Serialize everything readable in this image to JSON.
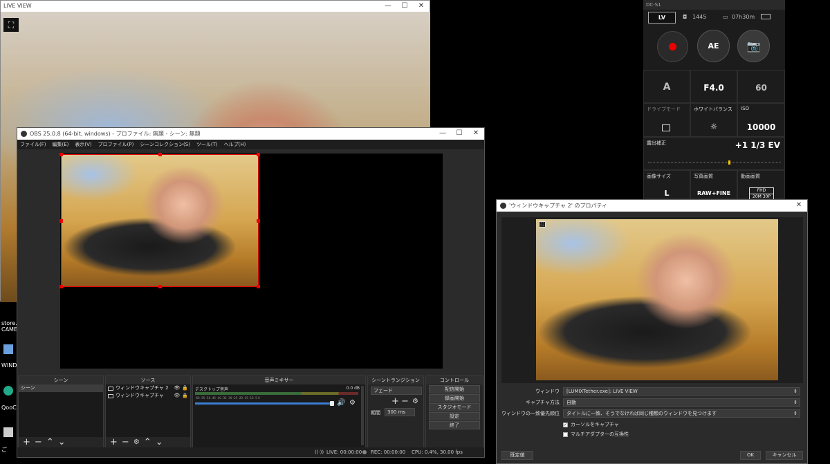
{
  "live_view": {
    "title": "LIVE VIEW"
  },
  "desktop": {
    "icon1_label": "store.m",
    "icon1_sub": "CAME",
    "icon2_label": "WINDO",
    "icon3_label": "QooC",
    "icon4_label": "ご"
  },
  "obs": {
    "title": "OBS 25.0.8 (64-bit, windows) - プロファイル: 無題 - シーン: 無題",
    "menu": [
      "ファイル(F)",
      "編集(E)",
      "表示(V)",
      "プロファイル(P)",
      "シーンコレクション(S)",
      "ツール(T)",
      "ヘルプ(H)"
    ],
    "docks": {
      "scenes": {
        "title": "シーン",
        "items": [
          "シーン"
        ]
      },
      "sources": {
        "title": "ソース",
        "items": [
          "ウィンドウキャプチャ 2",
          "ウィンドウキャプチャ"
        ]
      },
      "mixer": {
        "title": "音声ミキサー",
        "track": "デスクトップ音声",
        "db": "0.0 dB",
        "scale": "-60 -55 -50 -45 -40 -35 -30 -25 -20 -15 -10 -5 0"
      },
      "transitions": {
        "title": "シーントランジション",
        "mode": "フェード",
        "duration_label": "期間",
        "duration_value": "300 ms"
      },
      "controls": {
        "title": "コントロール",
        "buttons": [
          "配信開始",
          "録画開始",
          "スタジオモード",
          "設定",
          "終了"
        ]
      }
    },
    "status": {
      "live": "LIVE: 00:00:00",
      "rec": "REC: 00:00:00",
      "cpu": "CPU: 0.4%, 30.00 fps"
    }
  },
  "dcs1": {
    "title": "DC-S1",
    "lv": "LV",
    "shots": "1445",
    "battery": "07h30m",
    "ae": "AE",
    "mode": "A",
    "aperture": "F4.0",
    "shutter": "60",
    "drive_label": "ドライブモード",
    "wb_label": "ホワイトバランス",
    "iso_label": "ISO",
    "iso": "10000",
    "exp_label": "露出補正",
    "exp_value": "+1 1/3 EV",
    "size_label": "画像サイズ",
    "size": "L",
    "quality_label": "写真画質",
    "quality": "RAW+FINE",
    "video_label": "動画画質",
    "video_top": "FHD",
    "video_bottom": "20M 30P"
  },
  "props": {
    "title": "'ウィンドウキャプチャ 2' のプロパティ",
    "rows": [
      {
        "label": "ウィンドウ",
        "value": "[LUMIXTether.exe]: LIVE VIEW"
      },
      {
        "label": "キャプチャ方法",
        "value": "自動"
      },
      {
        "label": "ウィンドウの一致優先順位",
        "value": "タイトルに一致、そうでなければ同じ種類のウィンドウを見つけます"
      }
    ],
    "check1": "カーソルをキャプチャ",
    "check2": "マルチアダプターの互換性",
    "defaults": "既定値",
    "ok": "OK",
    "cancel": "キャンセル"
  }
}
